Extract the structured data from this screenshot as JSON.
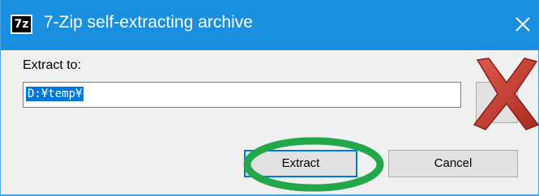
{
  "window": {
    "title": "7-Zip self-extracting archive",
    "app_icon_label": "7z",
    "close_glyph": "×"
  },
  "form": {
    "extract_label": "Extract to:",
    "path_value": "D:¥temp¥",
    "browse_label": "...",
    "extract_button_label": "Extract",
    "cancel_button_label": "Cancel"
  },
  "annotations": {
    "red_x": "cross-out-mark",
    "green_circle": "highlight-ring"
  },
  "colors": {
    "titlebar": "#1a8fe0",
    "selection": "#0078d7",
    "red_x": "#c0392b",
    "green_ring": "#22a84a"
  }
}
